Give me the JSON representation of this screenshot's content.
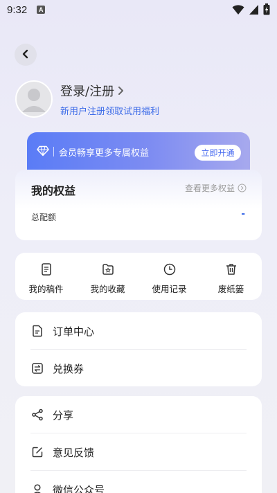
{
  "status_bar": {
    "time": "9:32",
    "notification_letter": "A"
  },
  "profile": {
    "login_label": "登录/注册",
    "subtitle": "新用户注册领取试用福利"
  },
  "vip": {
    "text": "会员畅享更多专属权益",
    "button": "立即开通"
  },
  "rights": {
    "title": "我的权益",
    "more_label": "查看更多权益",
    "quota_label": "总配额",
    "quota_value": "-"
  },
  "quick_actions": [
    {
      "label": "我的稿件",
      "icon": "document-icon"
    },
    {
      "label": "我的收藏",
      "icon": "favorite-folder-icon"
    },
    {
      "label": "使用记录",
      "icon": "clock-icon"
    },
    {
      "label": "废纸篓",
      "icon": "trash-icon"
    }
  ],
  "menu_group_1": [
    {
      "label": "订单中心",
      "icon": "order-icon"
    },
    {
      "label": "兑换券",
      "icon": "exchange-icon"
    }
  ],
  "menu_group_2": [
    {
      "label": "分享",
      "icon": "share-icon"
    },
    {
      "label": "意见反馈",
      "icon": "edit-icon"
    },
    {
      "label": "微信公众号",
      "icon": "user-icon"
    }
  ],
  "colors": {
    "accent": "#3c6be8",
    "vip_gradient_start": "#5a7cf6",
    "vip_gradient_end": "#a7a9ee"
  }
}
